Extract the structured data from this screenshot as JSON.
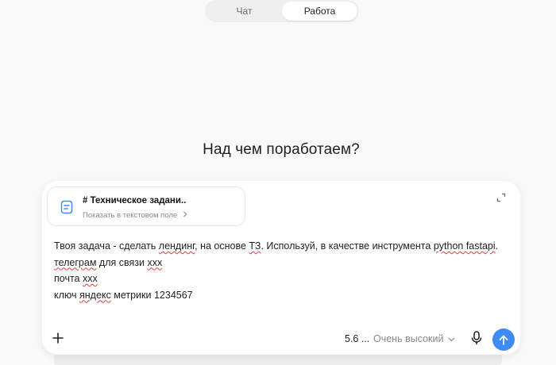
{
  "mode_switch": {
    "tabs": [
      {
        "label": "Чат",
        "active": false
      },
      {
        "label": "Работа",
        "active": true
      }
    ]
  },
  "headline": "Над чем поработаем?",
  "attachment": {
    "title": "# Техническое задани..",
    "subtitle": "Показать в текстовом поле",
    "icon": "document-icon"
  },
  "prompt": {
    "line1": {
      "a": "Твоя задача - сделать ",
      "b": "лендинг",
      "c": ", на основе ",
      "d": "ТЗ",
      "e": ". Используй, в качестве инструмента ",
      "f": "python fastapi",
      "g": "."
    },
    "line2": {
      "a": "телеграм",
      "b": " для связи ",
      "c": "xxx"
    },
    "line3": {
      "a": "почта ",
      "b": "xxx"
    },
    "line4": {
      "a": "ключ ",
      "b": "яндекс",
      "c": " метрики 1234567"
    }
  },
  "toolbar": {
    "model_label": "5.6 ...",
    "effort_value": "Очень высокий",
    "send_color": "#3e8bf5"
  }
}
